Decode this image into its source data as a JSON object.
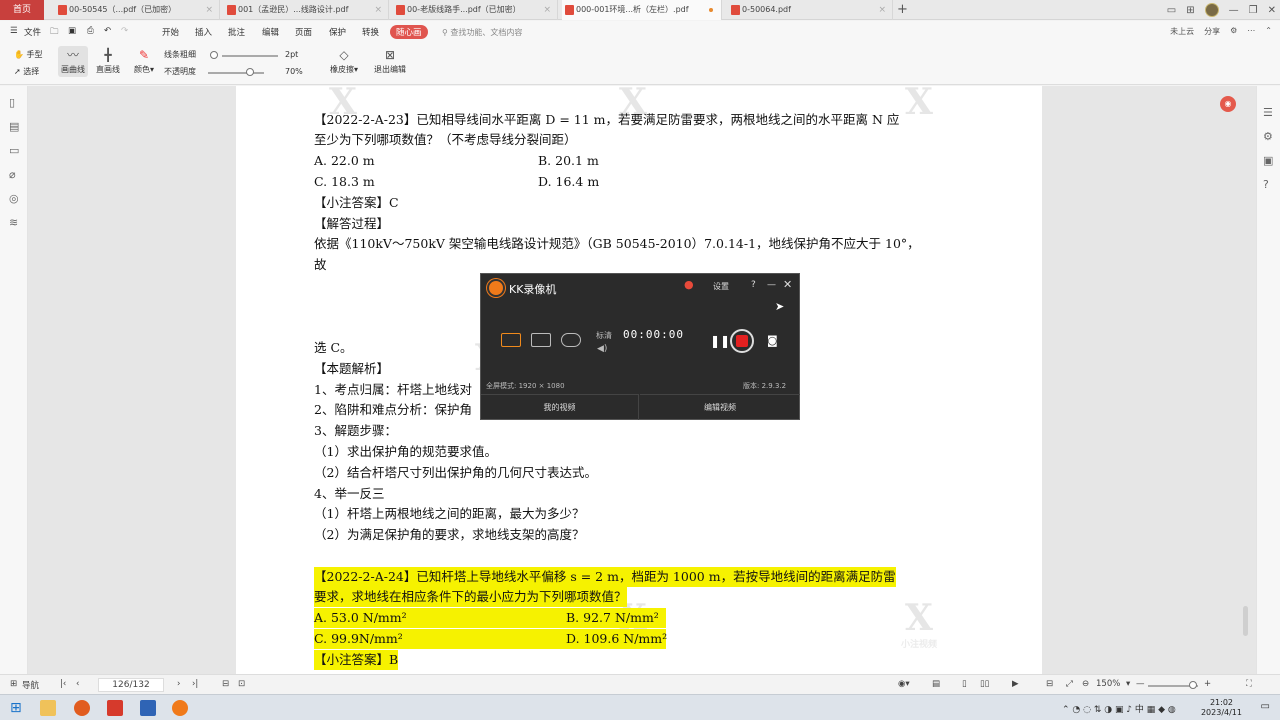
{
  "tabs": {
    "home": "首页",
    "docs": [
      {
        "title": "00-50545（...pdf（已加密）",
        "active": false
      },
      {
        "title": "001（孟逊民）...线路设计.pdf",
        "active": false
      },
      {
        "title": "00-老版线路手...pdf（已加密）",
        "active": false
      },
      {
        "title": "000-001环境...析（左栏）.pdf",
        "active": true
      },
      {
        "title": "0-50064.pdf",
        "active": false
      }
    ]
  },
  "menu": {
    "file": "文件",
    "items": [
      "开始",
      "插入",
      "批注",
      "编辑",
      "页面",
      "保护",
      "转换"
    ],
    "highlight": "随心画",
    "search_hint": "查找功能、文档内容",
    "right": [
      "未上云",
      "分享"
    ]
  },
  "toolbar": {
    "hand": "手型",
    "select": "选择",
    "draw_curve": "画曲线",
    "draw_line": "直画线",
    "color": "颜色",
    "line_weight": "线条粗细",
    "opacity": "不透明度",
    "weight_value": "2pt",
    "opacity_value": "70%",
    "eraser": "橡皮擦",
    "exit_edit": "退出编辑"
  },
  "document": {
    "q23_line1": "【2022-2-A-23】已知相导线间水平距离  D = 11 m，若要满足防雷要求，两根地线之间的水平距离  N  应",
    "q23_line2": "至少为下列哪项数值？（不考虑导线分裂间距）",
    "q23_options": [
      "A. 22.0 m",
      "B. 20.1 m",
      "C. 18.3 m",
      "D. 16.4 m"
    ],
    "answer_label": "【小注答案】C",
    "process_label": "【解答过程】",
    "process_line1": "依据《110kV～750kV 架空输电线路设计规范》（GB 50545-2010）7.0.14-1，地线保护角不应大于 10°，",
    "process_line2": "故",
    "choose": "选 C。",
    "analysis_label": "【本题解析】",
    "analysis_1": "1、考点归属：杆塔上地线对",
    "analysis_2": "2、陷阱和难点分析：保护角",
    "analysis_3": "3、解题步骤：",
    "step_1": "（1）求出保护角的规范要求值。",
    "step_2": "（2）结合杆塔尺寸列出保护角的几何尺寸表达式。",
    "analysis_4": "4、举一反三",
    "ext_1": "（1）杆塔上两根地线之间的距离，最大为多少？",
    "ext_2": "（2）为满足保护角的要求，求地线支架的高度？",
    "q24_line1": "【2022-2-A-24】已知杆塔上导地线水平偏移  s = 2 m，档距为 1000 m，若按导地线间的距离满足防雷",
    "q24_line2": "要求，求地线在相应条件下的最小应力为下列哪项数值？",
    "q24_options": [
      "A. 53.0 N/mm²",
      "B. 92.7 N/mm²",
      "C. 99.9N/mm²",
      "D. 109.6 N/mm²"
    ],
    "q24_answer": "【小注答案】B",
    "watermark": "小注视频"
  },
  "recorder": {
    "title": "KK录像机",
    "settings": "设置",
    "help": "?",
    "quality": "标清",
    "timer": "00:00:00",
    "mode_info": "全屏模式: 1920 × 1080",
    "version": "版本: 2.9.3.2",
    "my_videos": "我的视频",
    "edit_video": "编辑视频"
  },
  "status": {
    "nav": "导航",
    "page": "126/132",
    "zoom": "150%"
  },
  "taskbar": {
    "time": "21:02",
    "date": "2023/4/11"
  },
  "colors": {
    "home_tab": "#c8403d",
    "highlight": "#f6f200",
    "recorder_bg": "#2b2b2b",
    "record_red": "#e32020"
  }
}
